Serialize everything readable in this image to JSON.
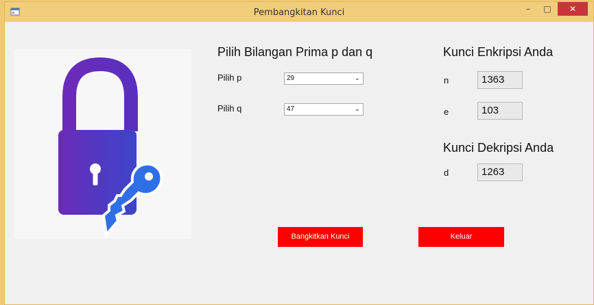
{
  "window": {
    "title": "Pembangkitan Kunci",
    "controls": {
      "minimize": "–",
      "maximize": "□",
      "close": "✕"
    }
  },
  "prime_section": {
    "heading": "Pilih Bilangan Prima p dan q",
    "p": {
      "label": "Pilih p",
      "value": "29"
    },
    "q": {
      "label": "Pilih q",
      "value": "47"
    }
  },
  "encryption_key": {
    "heading": "Kunci Enkripsi Anda",
    "n": {
      "label": "n",
      "value": "1363"
    },
    "e": {
      "label": "e",
      "value": "103"
    }
  },
  "decryption_key": {
    "heading": "Kunci Dekripsi Anda",
    "d": {
      "label": "d",
      "value": "1263"
    }
  },
  "buttons": {
    "generate": "Bangkitkan Kunci",
    "exit": "Keluar"
  },
  "icons": {
    "app": "form-icon",
    "illustration": "padlock-with-key-icon",
    "dropdown": "chevron-down-icon"
  },
  "colors": {
    "titlebar": "#f2cd7c",
    "button": "#fd0000",
    "close_button": "#c7363c",
    "lock_gradient_start": "#6a2bb8",
    "lock_gradient_end": "#3b45c9",
    "key": "#2f6fe6"
  }
}
